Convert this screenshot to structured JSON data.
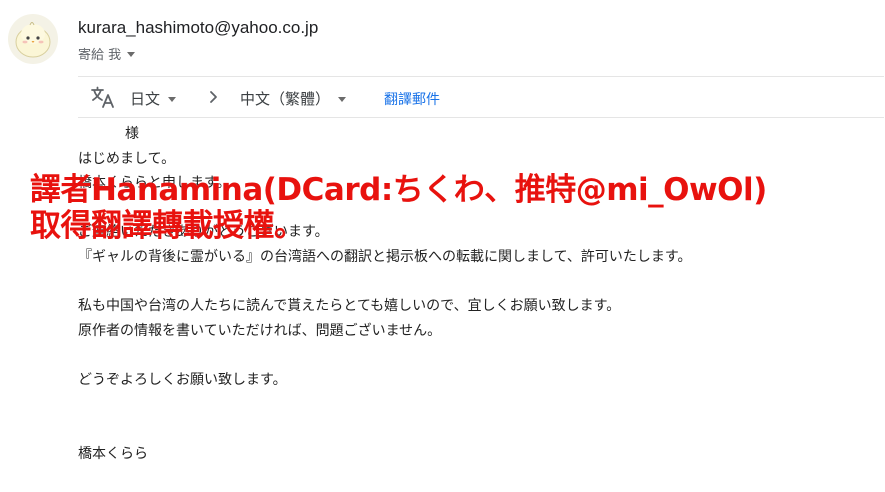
{
  "header": {
    "sender_email": "kurara_hashimoto@yahoo.co.jp",
    "recipient_label": "寄給 我"
  },
  "translate_bar": {
    "source_language": "日文",
    "target_language": "中文（繁體）",
    "translate_link": "翻譯郵件"
  },
  "body": {
    "salutation": "様",
    "lines": [
      "はじめまして。",
      "橋本くららと申します。",
      "",
      "ご連絡いただきありがとうございます。",
      "『ギャルの背後に霊がいる』の台湾語への翻訳と掲示板への転載に関しまして、許可いたします。",
      "",
      "私も中国や台湾の人たちに読んで貰えたらとても嬉しいので、宜しくお願い致します。",
      "原作者の情報を書いていただければ、問題ございません。",
      "",
      "どうぞよろしくお願い致します。",
      "",
      "",
      "橋本くらら"
    ]
  },
  "overlay": {
    "line1": "譯者Hanamina(DCard:ちくわ、推特@mi_OwOl)",
    "line2": "取得翻譯轉載授權。"
  },
  "colors": {
    "overlay_red": "#e8120e",
    "link_blue": "#1a73e8",
    "secondary_text": "#5f6368"
  },
  "icons": {
    "avatar": "avatar-chick-illustration",
    "translate": "translate-icon",
    "chevron": "chevron-right-icon",
    "dropdown": "caret-down-icon"
  }
}
